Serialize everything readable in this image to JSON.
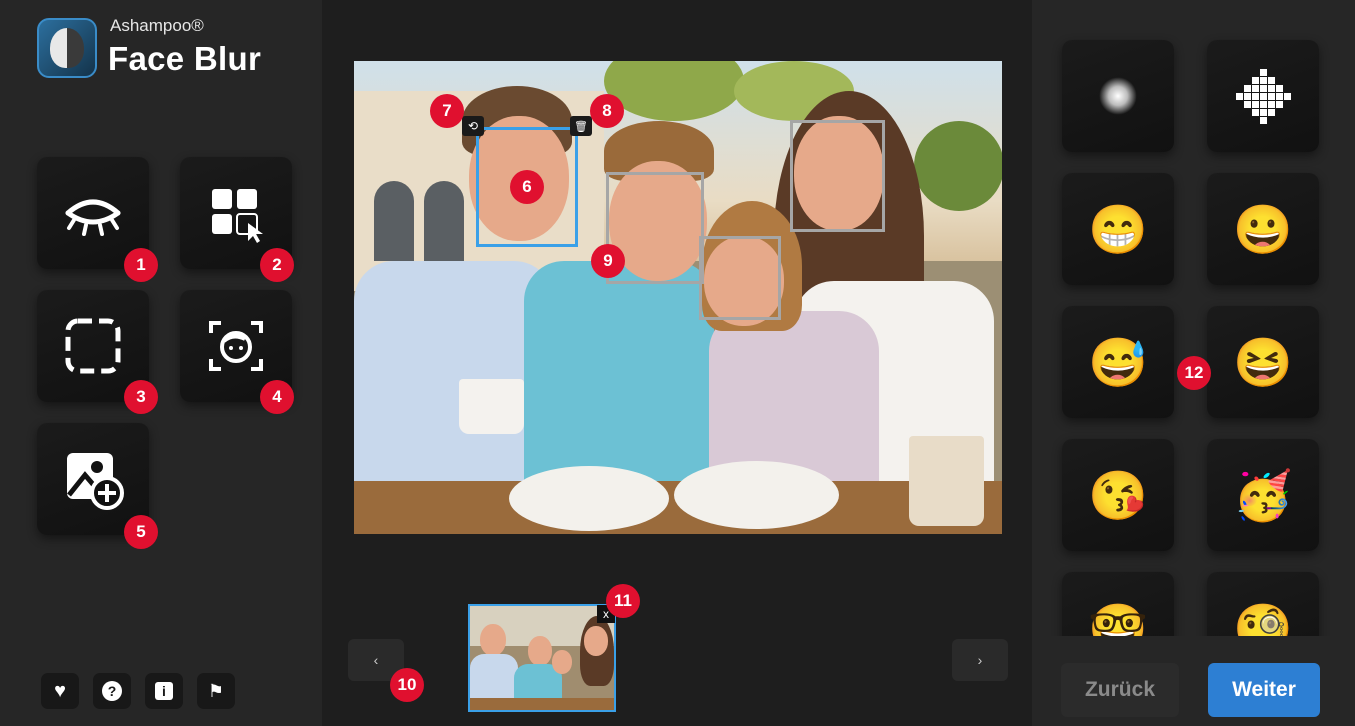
{
  "brand": {
    "vendor": "Ashampoo®",
    "product": "Face Blur"
  },
  "tools": [
    {
      "name": "hide-faces-tool",
      "icon": "closed-eye-icon",
      "badge": "1"
    },
    {
      "name": "mode-select-tool",
      "icon": "grid-cursor-icon",
      "badge": "2"
    },
    {
      "name": "manual-area-tool",
      "icon": "dashed-square-icon",
      "badge": "3"
    },
    {
      "name": "face-detect-tool",
      "icon": "face-scan-icon",
      "badge": "4"
    },
    {
      "name": "add-image-tool",
      "icon": "image-add-icon",
      "badge": "5"
    }
  ],
  "footer_buttons": [
    {
      "icon": "heart-icon",
      "glyph": "♥"
    },
    {
      "icon": "help-icon",
      "glyph": "?"
    },
    {
      "icon": "info-icon",
      "glyph": "i"
    },
    {
      "icon": "flag-icon",
      "glyph": "⚑"
    }
  ],
  "canvas": {
    "badges": {
      "selected_face": "6",
      "restore": "7",
      "delete": "8",
      "face_box": "9",
      "navigation": "10",
      "thumbnail_remove": "11",
      "effects": "12"
    },
    "restore_icon": "⟲",
    "delete_icon": "🗑"
  },
  "navigation": {
    "prev": "‹",
    "next": "›",
    "thumb_close": "x"
  },
  "effects": [
    {
      "name": "effect-blur",
      "kind": "blur"
    },
    {
      "name": "effect-pixelate",
      "kind": "pixel"
    },
    {
      "name": "effect-grin",
      "emoji": "😁"
    },
    {
      "name": "effect-smile",
      "emoji": "😀"
    },
    {
      "name": "effect-sweat-smile",
      "emoji": "😅"
    },
    {
      "name": "effect-laugh",
      "emoji": "😆"
    },
    {
      "name": "effect-kiss",
      "emoji": "😘"
    },
    {
      "name": "effect-party",
      "emoji": "🥳"
    },
    {
      "name": "effect-nerd",
      "emoji": "🤓"
    },
    {
      "name": "effect-glasses",
      "emoji": "🧐"
    }
  ],
  "actions": {
    "back": "Zurück",
    "next": "Weiter"
  },
  "colors": {
    "accent": "#2d7fd3",
    "badge": "#e0102f",
    "selection": "#3aa0e8"
  }
}
